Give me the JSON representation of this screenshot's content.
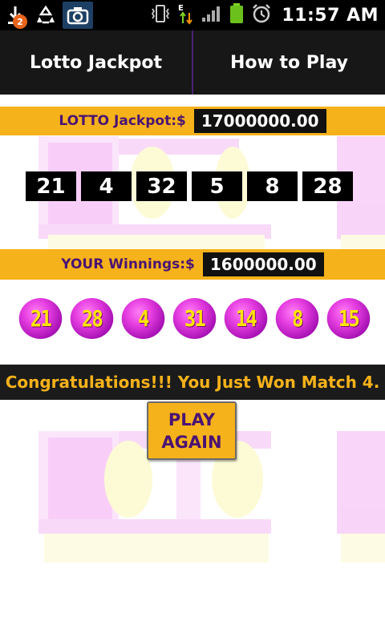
{
  "status_bar": {
    "notification_count": "2",
    "time": "11:57 AM"
  },
  "tabs": [
    {
      "label": "Lotto Jackpot"
    },
    {
      "label": "How to Play"
    }
  ],
  "jackpot": {
    "label": "LOTTO Jackpot:$",
    "value": "17000000.00",
    "numbers": [
      "21",
      "4",
      "32",
      "5",
      "8",
      "28"
    ]
  },
  "winnings": {
    "label": "YOUR Winnings:$",
    "value": "1600000.00",
    "balls": [
      "21",
      "28",
      "4",
      "31",
      "14",
      "8",
      "15"
    ]
  },
  "message": "Congratulations!!! You Just Won Match 4.",
  "play_again": {
    "line1": "PLAY",
    "line2": "AGAIN"
  },
  "colors": {
    "accent": "#f6b21a",
    "brand_purple": "#4a1373",
    "ball_magenta": "#e53de0",
    "ball_number": "#ffe600"
  }
}
